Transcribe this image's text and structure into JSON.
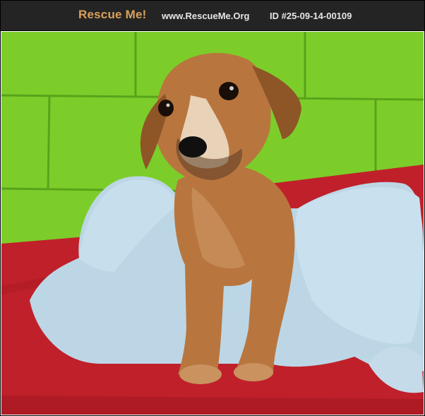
{
  "header": {
    "brand": "Rescue Me!",
    "site_url": "www.RescueMe.Org",
    "pet_id": "ID #25-09-14-00109"
  },
  "photo": {
    "subject": "dog-photo",
    "colors": {
      "wall_green": "#7ccd2a",
      "blanket_red": "#c0202a",
      "plush_blue": "#bcd6e6",
      "puppy_tan": "#b8763e"
    }
  }
}
